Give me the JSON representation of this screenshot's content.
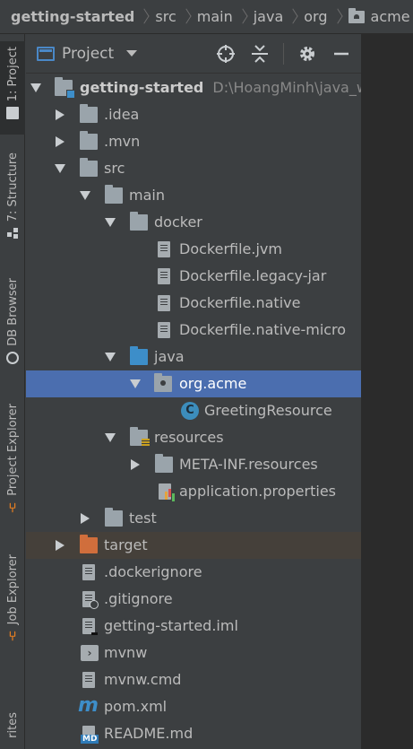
{
  "breadcrumb": [
    "getting-started",
    "src",
    "main",
    "java",
    "org",
    "acme"
  ],
  "toolwindows": {
    "project": "1: Project",
    "structure": "7: Structure",
    "db_browser": "DB Browser",
    "project_explorer": "Project Explorer",
    "job_explorer": "Job Explorer",
    "favorites": "rites"
  },
  "panel": {
    "title": "Project"
  },
  "tree": {
    "root_label": "getting-started",
    "root_path": "D:\\HoangMinh\\java_w",
    "idea": ".idea",
    "mvn": ".mvn",
    "src": "src",
    "main": "main",
    "docker": "docker",
    "dockerfile_jvm": "Dockerfile.jvm",
    "dockerfile_legacy": "Dockerfile.legacy-jar",
    "dockerfile_native": "Dockerfile.native",
    "dockerfile_native_micro": "Dockerfile.native-micro",
    "java": "java",
    "org_acme": "org.acme",
    "greeting": "GreetingResource",
    "resources": "resources",
    "meta_inf": "META-INF.resources",
    "app_props": "application.properties",
    "test": "test",
    "target": "target",
    "dockerignore": ".dockerignore",
    "gitignore": ".gitignore",
    "iml": "getting-started.iml",
    "mvnw": "mvnw",
    "mvnw_cmd": "mvnw.cmd",
    "pom": "pom.xml",
    "readme": "README.md"
  },
  "colors": {
    "background": "#3c3f41",
    "selection": "#4b6eaf",
    "excluded": "#45403a",
    "source_folder": "#3d8ec9",
    "excluded_folder": "#d06e3c"
  }
}
